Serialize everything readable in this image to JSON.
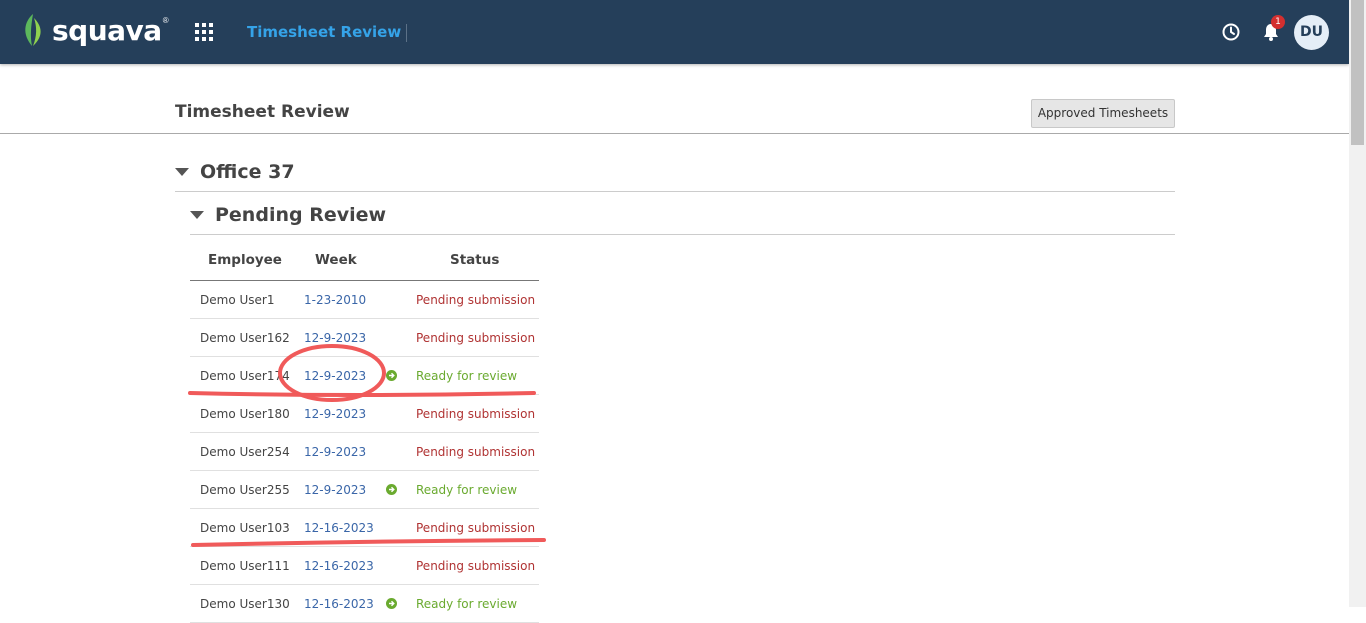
{
  "header": {
    "logo_text": "squava",
    "logo_tm": "®",
    "nav_title": "Timesheet Review",
    "notification_count": "1",
    "avatar_initials": "DU",
    "icons": [
      "apps-grid-icon",
      "clock-icon",
      "bell-icon"
    ],
    "bg_color": "#253f5a",
    "accent_color": "#35a3e8"
  },
  "page": {
    "title": "Timesheet Review",
    "approved_button_label": "Approved Timesheets"
  },
  "office": {
    "name": "Office 37",
    "group": {
      "title": "Pending Review",
      "columns": [
        "Employee",
        "Week",
        "Status"
      ],
      "rows": [
        {
          "employee": "Demo User1",
          "week": "1-23-2010",
          "status": "Pending submission",
          "ready": false
        },
        {
          "employee": "Demo User162",
          "week": "12-9-2023",
          "status": "Pending submission",
          "ready": false
        },
        {
          "employee": "Demo User174",
          "week": "12-9-2023",
          "status": "Ready for review",
          "ready": true
        },
        {
          "employee": "Demo User180",
          "week": "12-9-2023",
          "status": "Pending submission",
          "ready": false
        },
        {
          "employee": "Demo User254",
          "week": "12-9-2023",
          "status": "Pending submission",
          "ready": false
        },
        {
          "employee": "Demo User255",
          "week": "12-9-2023",
          "status": "Ready for review",
          "ready": true
        },
        {
          "employee": "Demo User103",
          "week": "12-16-2023",
          "status": "Pending submission",
          "ready": false
        },
        {
          "employee": "Demo User111",
          "week": "12-16-2023",
          "status": "Pending submission",
          "ready": false
        },
        {
          "employee": "Demo User130",
          "week": "12-16-2023",
          "status": "Ready for review",
          "ready": true
        }
      ]
    }
  },
  "colors": {
    "pending_status": "#b03333",
    "ready_status": "#6aaa2f",
    "week_link": "#3a66a8",
    "annotation": "#f05a5a"
  }
}
